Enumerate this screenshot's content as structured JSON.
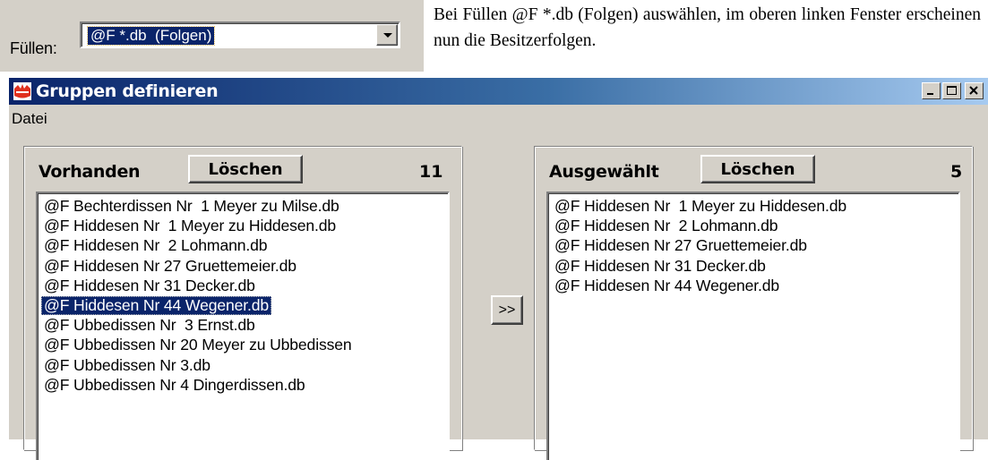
{
  "fill": {
    "label": "Füllen:",
    "value": "@F *.db  (Folgen)"
  },
  "note": "Bei Füllen @F *.db (Folgen) auswählen, im oberen linken Fenster erscheinen nun die Besitzerfolgen.",
  "window": {
    "title": "Gruppen definieren",
    "menu": [
      "Datei"
    ]
  },
  "available": {
    "title": "Vorhanden",
    "delete_label": "Löschen",
    "count": "11",
    "selected_index": 5,
    "items": [
      "@F Bechterdissen Nr  1 Meyer zu Milse.db",
      "@F Hiddesen Nr  1 Meyer zu Hiddesen.db",
      "@F Hiddesen Nr  2 Lohmann.db",
      "@F Hiddesen Nr 27 Gruettemeier.db",
      "@F Hiddesen Nr 31 Decker.db",
      "@F Hiddesen Nr 44 Wegener.db",
      "@F Ubbedissen Nr  3 Ernst.db",
      "@F Ubbedissen Nr 20 Meyer zu Ubbedissen",
      "@F Ubbedissen Nr 3.db",
      "@F Ubbedissen Nr 4 Dingerdissen.db"
    ]
  },
  "move_label": ">>",
  "selected_panel": {
    "title": "Ausgewählt",
    "delete_label": "Löschen",
    "count": "5",
    "items": [
      "@F Hiddesen Nr  1 Meyer zu Hiddesen.db",
      "@F Hiddesen Nr  2 Lohmann.db",
      "@F Hiddesen Nr 27 Gruettemeier.db",
      "@F Hiddesen Nr 31 Decker.db",
      "@F Hiddesen Nr 44 Wegener.db"
    ]
  }
}
